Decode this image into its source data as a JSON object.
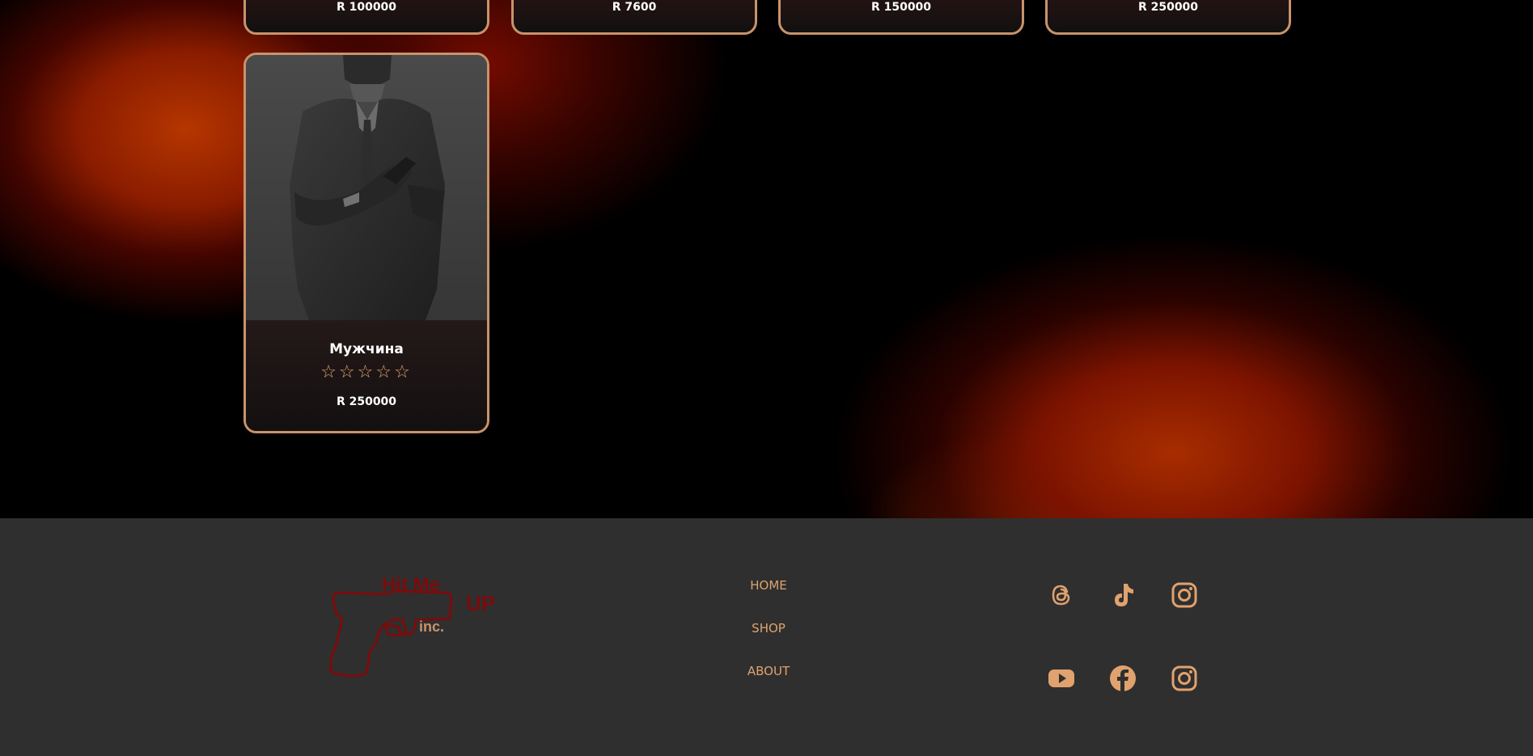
{
  "products_top_row": [
    {
      "price": "R 100000"
    },
    {
      "price": "R 7600"
    },
    {
      "price": "R 150000"
    },
    {
      "price": "R 250000"
    }
  ],
  "featured_product": {
    "name": "Мужчина",
    "rating_stars": "☆☆☆☆☆",
    "rating_value": 0,
    "rating_max": 5,
    "price": "R 250000"
  },
  "footer": {
    "logo": {
      "line1": "Hit Me",
      "line2": "UP",
      "line3": "inc."
    },
    "nav": [
      {
        "label": "HOME"
      },
      {
        "label": "SHOP"
      },
      {
        "label": "ABOUT"
      }
    ],
    "social_icons": [
      "threads-icon",
      "tiktok-icon",
      "instagram-icon",
      "youtube-icon",
      "facebook-icon",
      "instagram-icon"
    ]
  },
  "colors": {
    "accent": "#e0a26e",
    "card_border": "#c8936a",
    "footer_bg": "#2f2f2f",
    "logo_red": "#7a0c0c"
  }
}
